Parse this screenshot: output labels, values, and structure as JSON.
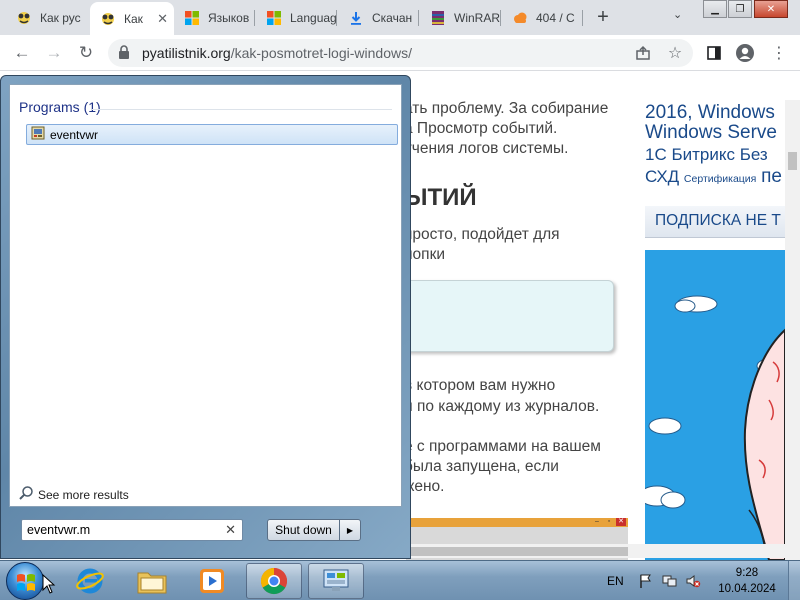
{
  "browser": {
    "tabs": [
      {
        "title": "Как рус",
        "icon": "face-icon",
        "active": false
      },
      {
        "title": "Как",
        "icon": "face-icon",
        "active": true
      },
      {
        "title": "Языков",
        "icon": "windows-logo-icon",
        "active": false
      },
      {
        "title": "Languag",
        "icon": "windows-logo-icon",
        "active": false
      },
      {
        "title": "Скачан",
        "icon": "download-icon",
        "active": false
      },
      {
        "title": "WinRAR",
        "icon": "winrar-icon",
        "active": false
      },
      {
        "title": "404 / С",
        "icon": "cloud-icon",
        "active": false
      }
    ],
    "url_domain": "pyatilistnik.org",
    "url_path": "/kak-posmotret-logi-windows/"
  },
  "page": {
    "lines": [
      "ать проблему. За собирание",
      "а Просмотр событий.",
      "учения логов системы."
    ],
    "heading": "ЫТИЙ",
    "para2": [
      "просто, подойдет для",
      "нопки"
    ],
    "para3": [
      "в котором вам нужно",
      "и по каждому из журналов."
    ],
    "para4": [
      "е с программами на вашем",
      "была запущена, если",
      "жено."
    ],
    "sidebar": {
      "line1": "2016, Windows",
      "line2": "Windows Serve",
      "line3": "1С Битрикс Без",
      "line4_big": "СХД",
      "line4_small": "Сертификация",
      "line4_end": "пе",
      "subscribe": "ПОДПИСКА НЕ Т"
    }
  },
  "start_menu": {
    "section_header": "Programs (1)",
    "results": [
      {
        "label": "eventvwr",
        "icon": "event-viewer-icon"
      }
    ],
    "see_more": "See more results",
    "search_value": "eventvwr.m",
    "shutdown_label": "Shut down"
  },
  "taskbar": {
    "language": "EN",
    "time": "9:28",
    "date": "10.04.2024"
  },
  "colors": {
    "accent": "#1e3287",
    "taskbar": "#7f9fbd",
    "selection": "#cfe3f7"
  }
}
